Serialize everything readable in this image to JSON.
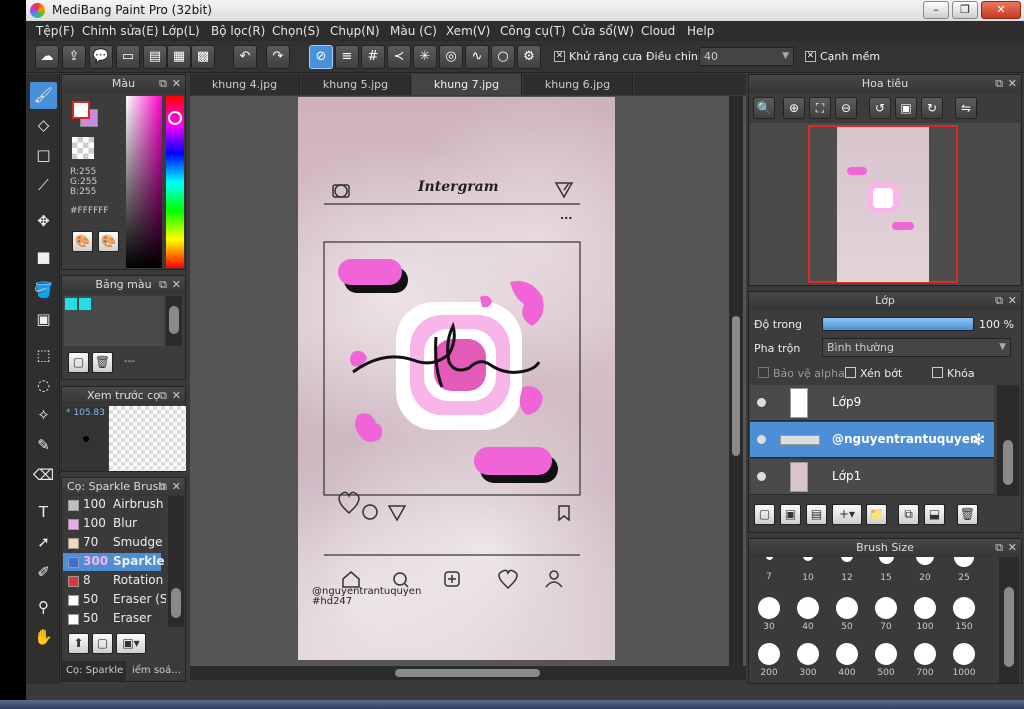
{
  "window": {
    "title": "MediBang Paint Pro (32bit)",
    "min": "–",
    "max": "❐",
    "close": "✕"
  },
  "menu": [
    "Tệp(F)",
    "Chỉnh sửa(E)",
    "Lớp(L)",
    "Bộ lọc(R)",
    "Chọn(S)",
    "Chụp(N)",
    "Màu (C)",
    "Xem(V)",
    "Công cụ(T)",
    "Cửa sổ(W)",
    "Cloud",
    "Help"
  ],
  "toolbar": {
    "antialias_label": "Khử răng cưa",
    "adjust_label": "Điều chỉnh",
    "adjust_value": "40",
    "edge_label": "Cạnh mềm",
    "check": "✕"
  },
  "color_panel": {
    "title": "Màu",
    "r": "R:255",
    "g": "G:255",
    "b": "B:255",
    "hex": "#FFFFFF",
    "primary": "#ffffff",
    "secondary": "#c98be0"
  },
  "palette_panel": {
    "title": "Bảng màu",
    "colors": [
      "#22e0e0",
      "#22e0e0"
    ],
    "dash": "---"
  },
  "preview_panel": {
    "title": "Xem trước cọ",
    "size": "105.83"
  },
  "brush_panel": {
    "title": "Cọ: Sparkle Brush",
    "brushes": [
      {
        "color": "#bfbfbf",
        "value": "100",
        "name": "Airbrush"
      },
      {
        "color": "#f2a8e8",
        "value": "100",
        "name": "Blur"
      },
      {
        "color": "#f6d9b3",
        "value": "70",
        "name": "Smudge"
      },
      {
        "color": "#3a6fd8",
        "value": "300",
        "name": "Sparkle"
      },
      {
        "color": "#e33535",
        "value": "8",
        "name": "Rotation"
      },
      {
        "color": "#ffffff",
        "value": "50",
        "name": "Eraser (S"
      },
      {
        "color": "#ffffff",
        "value": "50",
        "name": "Eraser"
      }
    ],
    "bottom_tabs": [
      "Cọ: Sparkle B...",
      "iểm soá..."
    ]
  },
  "tabs": [
    "khung 4.jpg",
    "khung 5.jpg",
    "khung 7.jpg",
    "khung 6.jpg"
  ],
  "artwork": {
    "app_name": "Intergram",
    "username": "@nguyentrantuquyen",
    "hashtag": "#hd247",
    "more": "..."
  },
  "navigator": {
    "title": "Hoa tiêu"
  },
  "layer_panel": {
    "title": "Lớp",
    "opacity_label": "Độ trong",
    "opacity_value": "100 %",
    "opacity_level": 1.0,
    "blend_label": "Pha trộn",
    "blend_value": "Bình thường",
    "protect_alpha": "Bảo vệ alpha",
    "clipping": "Xén bớt",
    "lock": "Khóa",
    "layers": [
      "Lớp9",
      "@nguyentrantuquyen",
      "Lớp1"
    ]
  },
  "brush_size_panel": {
    "title": "Brush Size",
    "sizes": [
      "7",
      "10",
      "12",
      "15",
      "20",
      "25",
      "30",
      "40",
      "50",
      "70",
      "100",
      "150",
      "200",
      "300",
      "400",
      "500",
      "700",
      "1000"
    ]
  }
}
